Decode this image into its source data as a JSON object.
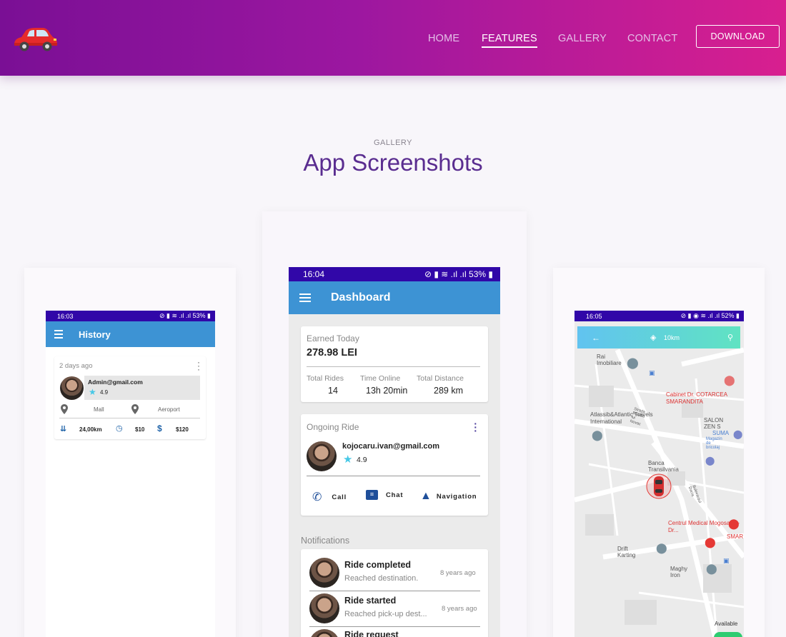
{
  "header": {
    "logo_icon": "car-icon",
    "nav": [
      "HOME",
      "FEATURES",
      "GALLERY",
      "CONTACT"
    ],
    "active_nav": "FEATURES",
    "download_label": "DOWNLOAD",
    "colors": {
      "gradient_start": "#7a0f95",
      "gradient_end": "#d81f8f"
    }
  },
  "section": {
    "label": "GALLERY",
    "title": "App Screenshots"
  },
  "left_phone": {
    "status_time": "16:03",
    "status_right": "53%",
    "title": "History",
    "card": {
      "time_ago": "2 days ago",
      "email": "Admin@gmail.com",
      "rating": "4.9",
      "from": "Mall",
      "to": "Aeroport",
      "distance": "24,00km",
      "cost1": "$10",
      "cost2": "$120"
    }
  },
  "center_phone": {
    "status_time": "16:04",
    "status_right": "53%",
    "title": "Dashboard",
    "earned_label": "Earned Today",
    "earned_value": "278.98 LEI",
    "stats": [
      {
        "label": "Total Rides",
        "value": "14"
      },
      {
        "label": "Time Online",
        "value": "13h 20min"
      },
      {
        "label": "Total Distance",
        "value": "289 km"
      }
    ],
    "ongoing": {
      "label": "Ongoing Ride",
      "email": "kojocaru.ivan@gmail.com",
      "rating": "4.9",
      "actions": [
        "Call",
        "Chat",
        "Navigation"
      ]
    },
    "notifications_label": "Notifications",
    "notifications": [
      {
        "title": "Ride completed",
        "subtitle": "Reached destination.",
        "time": "8 years ago"
      },
      {
        "title": "Ride started",
        "subtitle": "Reached pick-up dest...",
        "time": "8 years ago"
      },
      {
        "title": "Ride request",
        "subtitle": "",
        "time": ""
      }
    ]
  },
  "right_phone": {
    "status_time": "16:05",
    "status_right": "52%",
    "search_distance": "10km",
    "available_label": "Available",
    "map_labels": [
      "Rai Imobiliare",
      "Cabinet Dr. COTARCEA SMARANDITA",
      "Strada Brazda lui Novac",
      "Atlassib&Atlantic Travels International",
      "SALON ZEN S",
      "SUMA",
      "Magazin de bricolaj",
      "Banca Transilvania",
      "Bulevardul Dacia",
      "Centrul Medical Mogosanu - Dr...",
      "SMAR",
      "Drift Karting",
      "Maghy Iron"
    ]
  }
}
